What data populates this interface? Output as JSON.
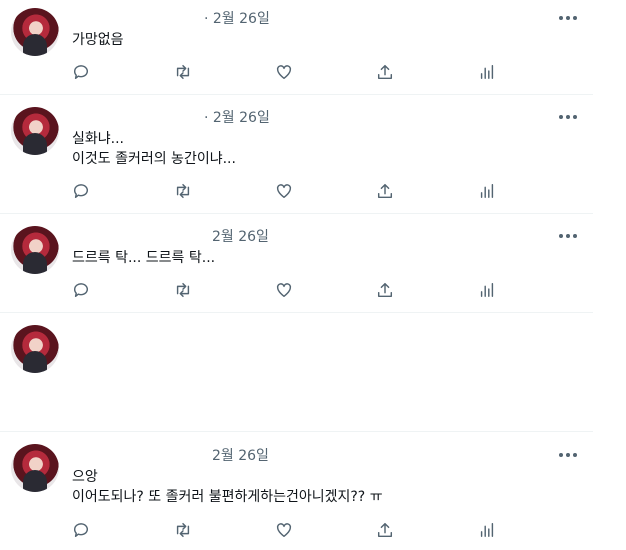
{
  "tweets": [
    {
      "date": "· 2월 26일",
      "lines": [
        "가망없음"
      ]
    },
    {
      "date": "· 2월 26일",
      "lines": [
        "실화냐...",
        "이것도 졸커러의 농간이냐..."
      ]
    },
    {
      "date": "2월 26일",
      "lines": [
        "드르륵 탁... 드르륵 탁..."
      ]
    },
    {
      "lines": []
    },
    {
      "date": "2월 26일",
      "lines": [
        "으앙",
        "이어도되나? 또 졸커러 불편하게하는건아니겠지?? ㅠ"
      ]
    }
  ],
  "icons": {
    "reply": "reply-icon",
    "retweet": "retweet-icon",
    "like": "heart-icon",
    "share": "share-icon",
    "analytics": "analytics-icon",
    "more": "more-icon",
    "avatar": "avatar"
  }
}
